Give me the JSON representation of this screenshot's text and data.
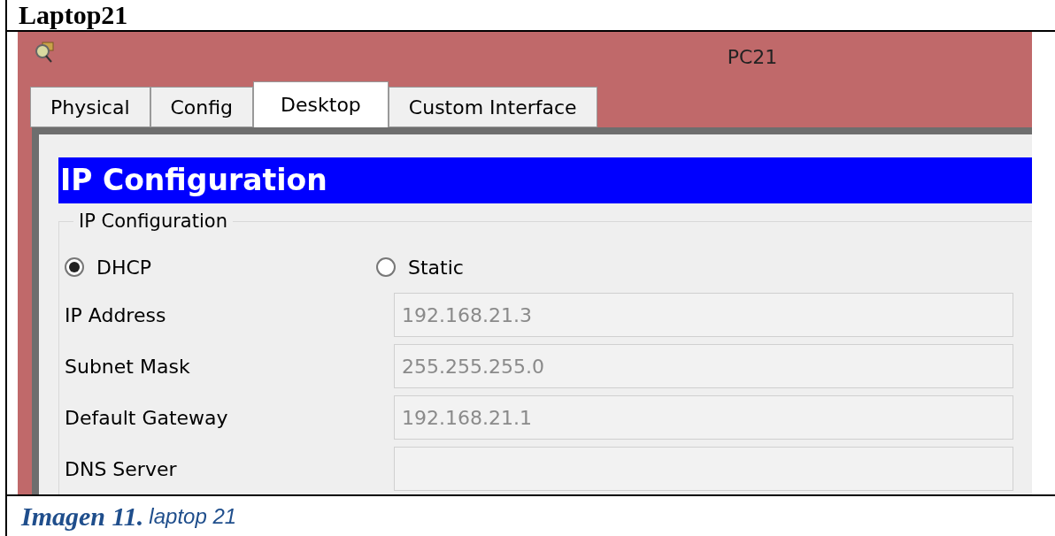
{
  "doc_heading": "Laptop21",
  "window": {
    "title": "PC21"
  },
  "tabs": [
    {
      "label": "Physical",
      "selected": false
    },
    {
      "label": "Config",
      "selected": false
    },
    {
      "label": "Desktop",
      "selected": true
    },
    {
      "label": "Custom Interface",
      "selected": false
    }
  ],
  "app_title": "IP Configuration",
  "group": {
    "legend": "IP Configuration",
    "modes": [
      {
        "label": "DHCP",
        "selected": true
      },
      {
        "label": "Static",
        "selected": false
      }
    ],
    "fields": [
      {
        "label": "IP Address",
        "value": "192.168.21.3"
      },
      {
        "label": "Subnet Mask",
        "value": "255.255.255.0"
      },
      {
        "label": "Default Gateway",
        "value": "192.168.21.1"
      },
      {
        "label": "DNS Server"
      }
    ]
  },
  "caption": {
    "number": "Imagen 11.",
    "text": "laptop 21"
  }
}
